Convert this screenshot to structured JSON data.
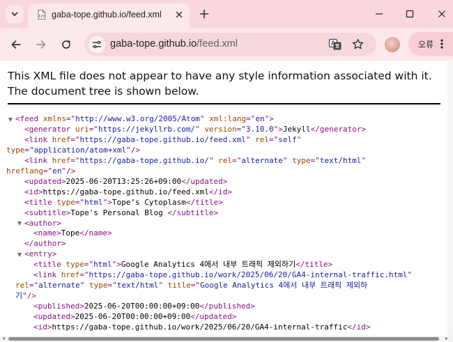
{
  "colors": {
    "tabstrip_bg": "#f9d7dc",
    "toolbar_bg": "#fde8eb",
    "omnibox_bg": "#f6d8dc",
    "tag": "#881280",
    "attr_name": "#994500",
    "attr_value": "#1a1aa6"
  },
  "tabstrip": {
    "search_tabs_icon": "chevron-down-icon",
    "tab": {
      "title": "gaba-tope.github.io/feed.xml",
      "favicon": "xml-file-icon",
      "close_icon": "close-icon"
    },
    "new_tab_icon": "plus-icon",
    "window_controls": [
      "minimize-icon",
      "maximize-icon",
      "close-icon"
    ]
  },
  "toolbar": {
    "back_icon": "arrow-left-icon",
    "forward_icon": "arrow-right-icon",
    "reload_icon": "reload-icon",
    "site_info_icon": "tune-icon",
    "url_host": "gaba-tope.github.io",
    "url_path": "/feed.xml",
    "translate_icon": "translate-icon",
    "bookmark_icon": "star-icon",
    "profile_label": "오류",
    "menu_icon": "more-vert-icon"
  },
  "content": {
    "notice": "This XML file does not appear to have any style information associated with it. The document tree is shown below.",
    "lines": [
      {
        "i": 0,
        "c": true,
        "t": [
          [
            "tag",
            "<feed"
          ],
          [
            "t",
            " "
          ],
          [
            "a",
            "xmlns"
          ],
          [
            "tag",
            "=\""
          ],
          [
            "v",
            "http://www.w3.org/2005/Atom"
          ],
          [
            "tag",
            "\""
          ],
          [
            "t",
            " "
          ],
          [
            "a",
            "xml:lang"
          ],
          [
            "tag",
            "=\""
          ],
          [
            "v",
            "en"
          ],
          [
            "tag",
            "\">"
          ]
        ]
      },
      {
        "i": 1,
        "t": [
          [
            "tag",
            "<generator"
          ],
          [
            "t",
            " "
          ],
          [
            "a",
            "uri"
          ],
          [
            "tag",
            "=\""
          ],
          [
            "v",
            "https://jekyllrb.com/"
          ],
          [
            "tag",
            "\""
          ],
          [
            "t",
            " "
          ],
          [
            "a",
            "version"
          ],
          [
            "tag",
            "=\""
          ],
          [
            "v",
            "3.10.0"
          ],
          [
            "tag",
            "\">"
          ],
          [
            "t",
            "Jekyll"
          ],
          [
            "tag",
            "</generator>"
          ]
        ]
      },
      {
        "i": 1,
        "t": [
          [
            "tag",
            "<link"
          ],
          [
            "t",
            " "
          ],
          [
            "a",
            "href"
          ],
          [
            "tag",
            "=\""
          ],
          [
            "v",
            "https://gaba-tope.github.io/feed.xml"
          ],
          [
            "tag",
            "\""
          ],
          [
            "t",
            " "
          ],
          [
            "a",
            "rel"
          ],
          [
            "tag",
            "=\""
          ],
          [
            "v",
            "self"
          ],
          [
            "tag",
            "\""
          ]
        ]
      },
      {
        "i": 1,
        "o": -2,
        "t": [
          [
            "a",
            "type"
          ],
          [
            "tag",
            "=\""
          ],
          [
            "v",
            "application/atom+xml"
          ],
          [
            "tag",
            "\"/>"
          ]
        ]
      },
      {
        "i": 1,
        "t": [
          [
            "tag",
            "<link"
          ],
          [
            "t",
            " "
          ],
          [
            "a",
            "href"
          ],
          [
            "tag",
            "=\""
          ],
          [
            "v",
            "https://gaba-tope.github.io/"
          ],
          [
            "tag",
            "\""
          ],
          [
            "t",
            " "
          ],
          [
            "a",
            "rel"
          ],
          [
            "tag",
            "=\""
          ],
          [
            "v",
            "alternate"
          ],
          [
            "tag",
            "\""
          ],
          [
            "t",
            " "
          ],
          [
            "a",
            "type"
          ],
          [
            "tag",
            "=\""
          ],
          [
            "v",
            "text/html"
          ],
          [
            "tag",
            "\""
          ]
        ]
      },
      {
        "i": 1,
        "o": -2,
        "t": [
          [
            "a",
            "hreflang"
          ],
          [
            "tag",
            "=\""
          ],
          [
            "v",
            "en"
          ],
          [
            "tag",
            "\"/>"
          ]
        ]
      },
      {
        "i": 1,
        "t": [
          [
            "tag",
            "<updated>"
          ],
          [
            "t",
            "2025-06-20T13:25:26+09:00"
          ],
          [
            "tag",
            "</updated>"
          ]
        ]
      },
      {
        "i": 1,
        "t": [
          [
            "tag",
            "<id>"
          ],
          [
            "t",
            "https://gaba-tope.github.io/feed.xml"
          ],
          [
            "tag",
            "</id>"
          ]
        ]
      },
      {
        "i": 1,
        "t": [
          [
            "tag",
            "<title"
          ],
          [
            "t",
            " "
          ],
          [
            "a",
            "type"
          ],
          [
            "tag",
            "=\""
          ],
          [
            "v",
            "html"
          ],
          [
            "tag",
            "\">"
          ],
          [
            "t",
            "Tope’s Cytoplasm"
          ],
          [
            "tag",
            "</title>"
          ]
        ]
      },
      {
        "i": 1,
        "t": [
          [
            "tag",
            "<subtitle>"
          ],
          [
            "t",
            "Tope's Personal Blog "
          ],
          [
            "tag",
            "</subtitle>"
          ]
        ]
      },
      {
        "i": 1,
        "c": true,
        "t": [
          [
            "tag",
            "<author>"
          ]
        ]
      },
      {
        "i": 2,
        "t": [
          [
            "tag",
            "<name>"
          ],
          [
            "t",
            "Tope"
          ],
          [
            "tag",
            "</name>"
          ]
        ]
      },
      {
        "i": 1,
        "t": [
          [
            "tag",
            "</author>"
          ]
        ]
      },
      {
        "i": 1,
        "c": true,
        "t": [
          [
            "tag",
            "<entry>"
          ]
        ]
      },
      {
        "i": 2,
        "t": [
          [
            "tag",
            "<title"
          ],
          [
            "t",
            " "
          ],
          [
            "a",
            "type"
          ],
          [
            "tag",
            "=\""
          ],
          [
            "v",
            "html"
          ],
          [
            "tag",
            "\">"
          ],
          [
            "t",
            "Google Analytics 4에서 내부 트래픽 제외하기"
          ],
          [
            "tag",
            "</title>"
          ]
        ]
      },
      {
        "i": 2,
        "t": [
          [
            "tag",
            "<link"
          ],
          [
            "t",
            " "
          ],
          [
            "a",
            "href"
          ],
          [
            "tag",
            "=\""
          ],
          [
            "v",
            "https://gaba-tope.github.io/work/2025/06/20/GA4-internal-traffic.html"
          ],
          [
            "tag",
            "\""
          ]
        ]
      },
      {
        "i": 2,
        "o": -2,
        "t": [
          [
            "a",
            "rel"
          ],
          [
            "tag",
            "=\""
          ],
          [
            "v",
            "alternate"
          ],
          [
            "tag",
            "\""
          ],
          [
            "t",
            " "
          ],
          [
            "a",
            "type"
          ],
          [
            "tag",
            "=\""
          ],
          [
            "v",
            "text/html"
          ],
          [
            "tag",
            "\""
          ],
          [
            "t",
            " "
          ],
          [
            "a",
            "title"
          ],
          [
            "tag",
            "=\""
          ],
          [
            "v",
            "Google Analytics 4에서 내부 트래픽 제외하"
          ]
        ]
      },
      {
        "i": 2,
        "o": -2,
        "t": [
          [
            "v",
            "기"
          ],
          [
            "tag",
            "\"/>"
          ]
        ]
      },
      {
        "i": 2,
        "t": [
          [
            "tag",
            "<published>"
          ],
          [
            "t",
            "2025-06-20T00:00:00+09:00"
          ],
          [
            "tag",
            "</published>"
          ]
        ]
      },
      {
        "i": 2,
        "t": [
          [
            "tag",
            "<updated>"
          ],
          [
            "t",
            "2025-06-20T00:00:00+09:00"
          ],
          [
            "tag",
            "</updated>"
          ]
        ]
      },
      {
        "i": 2,
        "t": [
          [
            "tag",
            "<id>"
          ],
          [
            "t",
            "https://gaba-tope.github.io/work/2025/06/20/GA4-internal-traffic"
          ],
          [
            "tag",
            "</id>"
          ]
        ]
      }
    ]
  }
}
